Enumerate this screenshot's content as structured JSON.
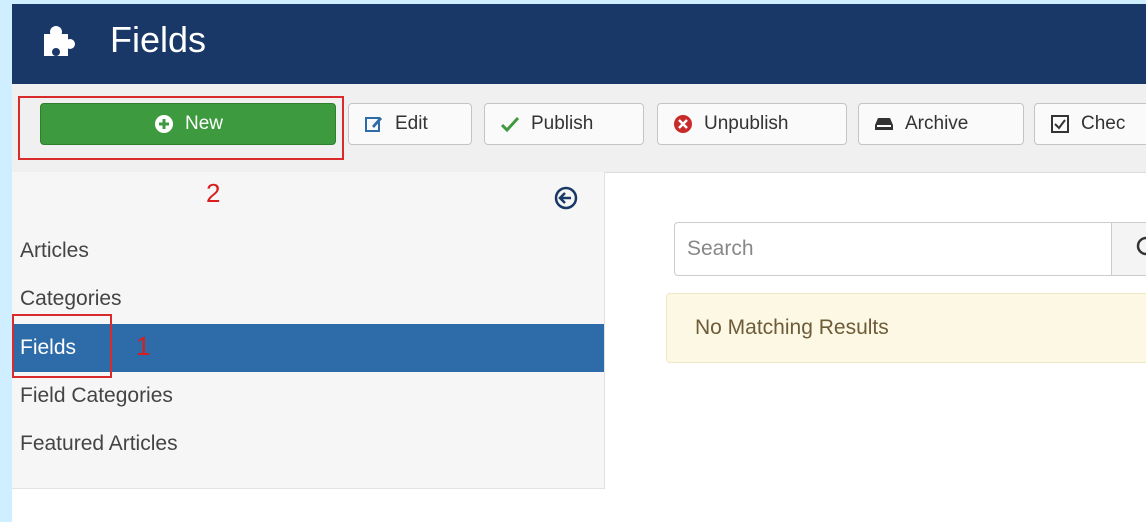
{
  "header": {
    "title": "Fields",
    "icon": "puzzle-piece-icon",
    "background": "#1a3867"
  },
  "toolbar": {
    "new_label": "New",
    "edit_label": "Edit",
    "publish_label": "Publish",
    "unpublish_label": "Unpublish",
    "archive_label": "Archive",
    "check_label": "Chec"
  },
  "annotations": {
    "step_1": "1",
    "step_2": "2",
    "color": "#d92b2b"
  },
  "sidebar": {
    "items": [
      {
        "label": "Articles",
        "active": false
      },
      {
        "label": "Categories",
        "active": false
      },
      {
        "label": "Fields",
        "active": true
      },
      {
        "label": "Field Categories",
        "active": false
      },
      {
        "label": "Featured Articles",
        "active": false
      }
    ],
    "active_color": "#2d6ca8"
  },
  "search": {
    "placeholder": "Search"
  },
  "alert": {
    "message": "No Matching Results"
  },
  "colors": {
    "new_button": "#3e9a3e",
    "alert_bg": "#fcf8e3"
  }
}
